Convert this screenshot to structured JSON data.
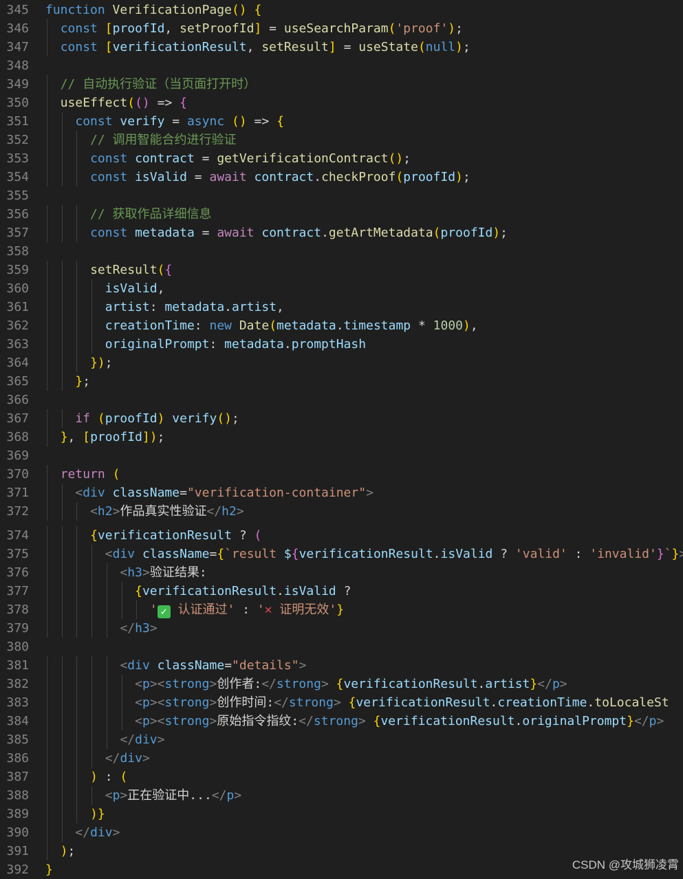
{
  "editor": {
    "lines": [
      {
        "n": "345",
        "s": "function VerificationPage() {"
      },
      {
        "n": "346",
        "s": "  const [proofId, setProofId] = useSearchParam('proof');"
      },
      {
        "n": "347",
        "s": "  const [verificationResult, setResult] = useState(null);"
      },
      {
        "n": "348",
        "s": ""
      },
      {
        "n": "349",
        "s": "  // 自动执行验证（当页面打开时）"
      },
      {
        "n": "350",
        "s": "  useEffect(() => {"
      },
      {
        "n": "351",
        "s": "    const verify = async () => {"
      },
      {
        "n": "352",
        "s": "      // 调用智能合约进行验证"
      },
      {
        "n": "353",
        "s": "      const contract = getVerificationContract();"
      },
      {
        "n": "354",
        "s": "      const isValid = await contract.checkProof(proofId);"
      },
      {
        "n": "355",
        "s": ""
      },
      {
        "n": "356",
        "s": "      // 获取作品详细信息"
      },
      {
        "n": "357",
        "s": "      const metadata = await contract.getArtMetadata(proofId);"
      },
      {
        "n": "358",
        "s": ""
      },
      {
        "n": "359",
        "s": "      setResult({"
      },
      {
        "n": "360",
        "s": "        isValid,"
      },
      {
        "n": "361",
        "s": "        artist: metadata.artist,"
      },
      {
        "n": "362",
        "s": "        creationTime: new Date(metadata.timestamp * 1000),"
      },
      {
        "n": "363",
        "s": "        originalPrompt: metadata.promptHash"
      },
      {
        "n": "364",
        "s": "      });"
      },
      {
        "n": "365",
        "s": "    };"
      },
      {
        "n": "366",
        "s": ""
      },
      {
        "n": "367",
        "s": "    if (proofId) verify();"
      },
      {
        "n": "368",
        "s": "  }, [proofId]);"
      },
      {
        "n": "369",
        "s": ""
      },
      {
        "n": "370",
        "s": "  return ("
      },
      {
        "n": "371",
        "s": "    <div className=\"verification-container\">"
      },
      {
        "n": "372",
        "s": "      <h2>作品真实性验证</h2>"
      },
      {
        "n": "374",
        "s": "      {verificationResult ? ("
      },
      {
        "n": "375",
        "s": "        <div className={`result ${verificationResult.isValid ? 'valid' : 'invalid'}`}>"
      },
      {
        "n": "376",
        "s": "          <h3>验证结果:"
      },
      {
        "n": "377",
        "s": "            {verificationResult.isValid ?"
      },
      {
        "n": "378",
        "s": "              '✅ 认证通过' : '❌ 证明无效'}"
      },
      {
        "n": "379",
        "s": "          </h3>"
      },
      {
        "n": "380",
        "s": ""
      },
      {
        "n": "381",
        "s": "          <div className=\"details\">"
      },
      {
        "n": "382",
        "s": "            <p><strong>创作者:</strong> {verificationResult.artist}</p>"
      },
      {
        "n": "383",
        "s": "            <p><strong>创作时间:</strong> {verificationResult.creationTime.toLocaleSt"
      },
      {
        "n": "384",
        "s": "            <p><strong>原始指令指纹:</strong> {verificationResult.originalPrompt}</p>"
      },
      {
        "n": "385",
        "s": "          </div>"
      },
      {
        "n": "386",
        "s": "        </div>"
      },
      {
        "n": "387",
        "s": "      ) : ("
      },
      {
        "n": "388",
        "s": "        <p>正在验证中...</p>"
      },
      {
        "n": "389",
        "s": "      )}"
      },
      {
        "n": "390",
        "s": "    </div>"
      },
      {
        "n": "391",
        "s": "  );"
      },
      {
        "n": "392",
        "s": "}"
      }
    ]
  },
  "watermark": "CSDN @攻城狮凌霄",
  "colors": {
    "background": "#1f1f1f",
    "line_number": "#858585",
    "keyword": "#569cd6",
    "control": "#c586c0",
    "function": "#dcdcaa",
    "variable": "#9cdcfe",
    "string": "#ce9178",
    "number": "#b5cea8",
    "comment": "#6a9955"
  }
}
